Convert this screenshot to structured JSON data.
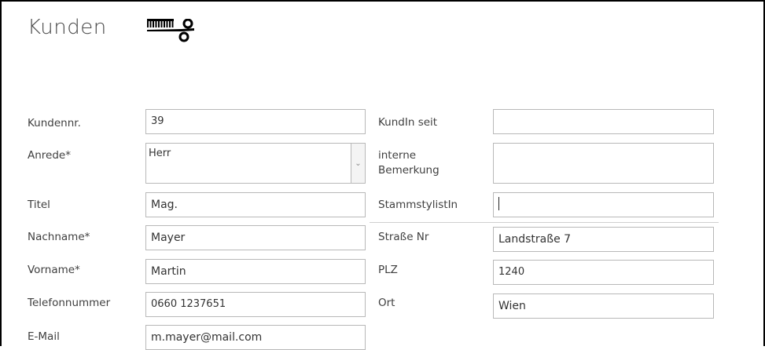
{
  "header": {
    "title": "Kunden",
    "logo_icon": "comb-scissors-icon"
  },
  "left_fields": [
    {
      "label": "Kundennr.",
      "value": "39"
    },
    {
      "label": "Anrede*",
      "value": "Herr"
    },
    {
      "label": "Titel",
      "value": "Mag."
    },
    {
      "label": "Nachname*",
      "value": "Mayer"
    },
    {
      "label": "Vorname*",
      "value": "Martin"
    },
    {
      "label": "Telefonnummer",
      "value": "0660 1237651"
    },
    {
      "label": "E-Mail",
      "value": "m.mayer@mail.com"
    }
  ],
  "right_fields": [
    {
      "label": "KundIn seit",
      "value": ""
    },
    {
      "label": "interne Bemerkung",
      "value": ""
    },
    {
      "label": "StammstylistIn",
      "value": ""
    },
    {
      "label": "Straße Nr",
      "value": "Landstraße 7"
    },
    {
      "label": "PLZ",
      "value": "1240"
    },
    {
      "label": "Ort",
      "value": "Wien"
    }
  ],
  "icons": {
    "dropdown": "chevron-down-icon"
  },
  "colors": {
    "field_border": "#b8b8b8",
    "frame_border": "#000000"
  }
}
